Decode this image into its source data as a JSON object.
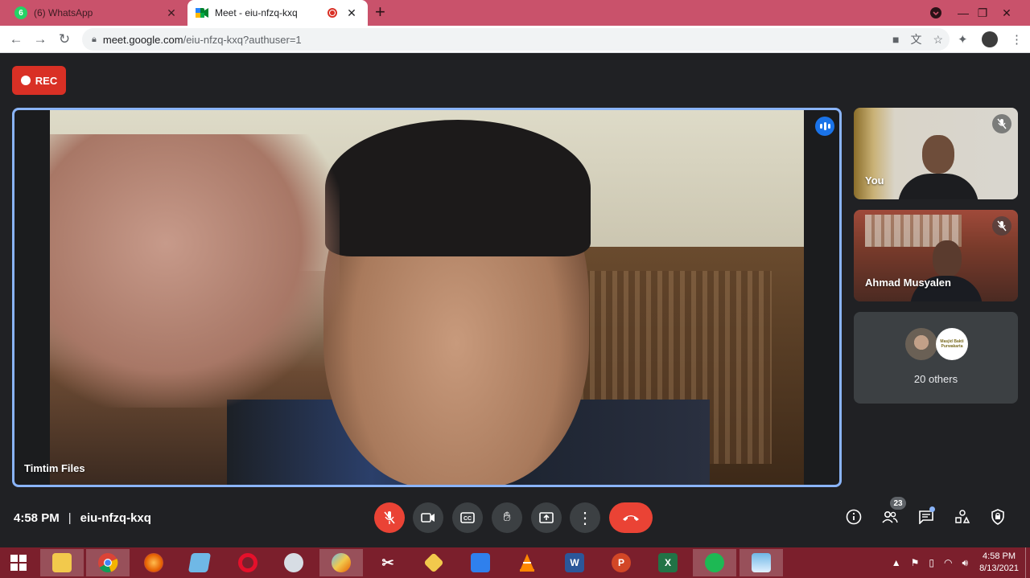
{
  "browser": {
    "tabs": [
      {
        "label": "(6) WhatsApp",
        "badge": "6",
        "active": false
      },
      {
        "label": "Meet - eiu-nfzq-kxq",
        "active": true
      }
    ],
    "url_host": "meet.google.com",
    "url_path": "/eiu-nfzq-kxq?authuser=1"
  },
  "meet": {
    "rec_label": "REC",
    "main_speaker_name": "Timtim Files",
    "participants": [
      {
        "name": "You",
        "muted": true
      },
      {
        "name": "Ahmad Musyalen",
        "muted": true
      }
    ],
    "others_label": "20 others",
    "others_avatar_text": "Masjid Bakti Purwakarta",
    "time": "4:58 PM",
    "separator": "|",
    "meeting_code": "eiu-nfzq-kxq",
    "people_count": "23",
    "accent_color": "#8ab4f8",
    "danger_color": "#ea4335"
  },
  "taskbar": {
    "time": "4:58 PM",
    "date": "8/13/2021",
    "color": "#7b1f2c"
  }
}
